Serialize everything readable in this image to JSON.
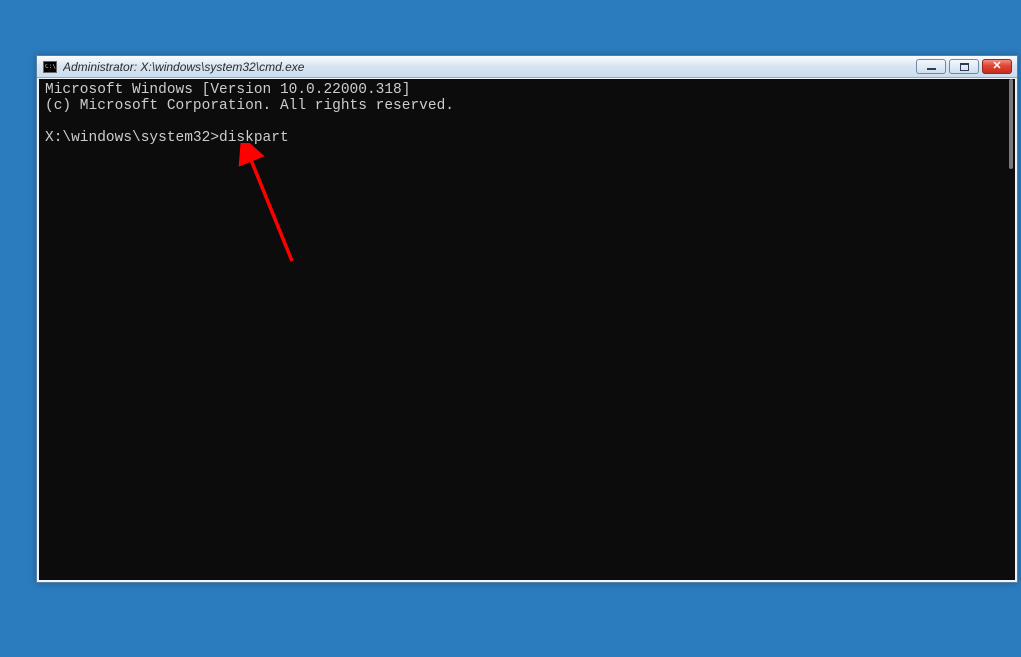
{
  "window": {
    "title": "Administrator: X:\\windows\\system32\\cmd.exe"
  },
  "terminal": {
    "line1": "Microsoft Windows [Version 10.0.22000.318]",
    "line2": "(c) Microsoft Corporation. All rights reserved.",
    "prompt": "X:\\windows\\system32>",
    "command": "diskpart"
  },
  "annotation": {
    "arrow_color": "#ff0000"
  }
}
